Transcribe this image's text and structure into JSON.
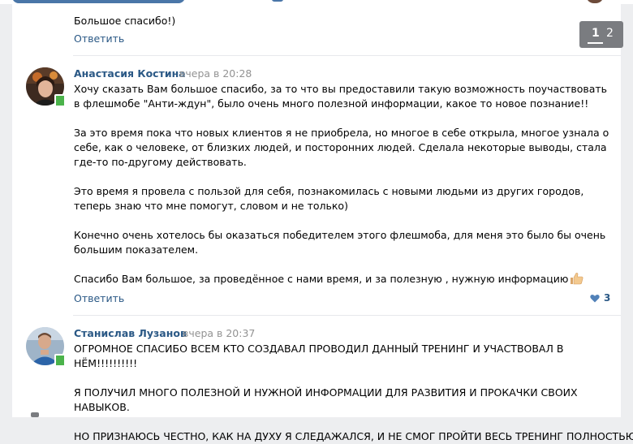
{
  "prev_comment": {
    "text": "Большое спасибо!)",
    "reply_label": "Ответить"
  },
  "pagination": {
    "current": "1",
    "next": "2"
  },
  "comments": [
    {
      "author": "Анастасия Костина",
      "date": "вчера в 20:28",
      "paragraphs": [
        "Хочу сказать Вам большое спасибо, за то что вы предоставили такую возможность поучаствовать в флешмобе \"Анти-ждун\", было очень много полезной информации, какое то новое познание!!",
        "За это время пока что новых клиентов я не приобрела, но многое в себе открыла, многое узнала о себе, как о человеке, от близких людей, и посторонних людей. Сделала некоторые выводы, стала где-то по-другому действовать.",
        "Это время я провела с пользой для себя, познакомилась с новыми людьми из других городов, теперь знаю что мне помогут, словом и не только)",
        "Конечно очень хотелось бы оказаться победителем этого флешмоба, для меня это было бы очень большим показателем.",
        "Спасибо Вам большое, за проведённое с нами время, и за полезную , нужную информацию"
      ],
      "emoji": "thumbs-up-icon",
      "reply_label": "Ответить",
      "likes": "3",
      "avatar_colors": [
        "#3d2a20",
        "#c46b2a"
      ]
    },
    {
      "author": "Станислав Лузанов",
      "date": "вчера в 20:37",
      "paragraphs": [
        "ОГРОМНОЕ СПАСИБО ВСЕМ КТО СОЗДАВАЛ ПРОВОДИЛ ДАННЫЙ ТРЕНИНГ И УЧАСТВОВАЛ В НЁМ!!!!!!!!!!",
        "Я ПОЛУЧИЛ МНОГО ПОЛЕЗНОЙ И НУЖНОЙ ИНФОРМАЦИИ ДЛЯ РАЗВИТИЯ И ПРОКАЧКИ СВОИХ НАВЫКОВ.",
        "НО ПРИЗНАЮСЬ ЧЕСТНО, КАК НА ДУХУ Я СЛЕДАЖАЛСЯ, И НЕ СМОГ ПРОЙТИ ВЕСЬ ТРЕНИНГ ПОЛНОСТЬЮ, ТАК"
      ],
      "avatar_colors": [
        "#9fb4c8",
        "#2c64a8"
      ]
    }
  ],
  "colors": {
    "link": "#2a5885",
    "date": "#939393",
    "online": "#4bb34b",
    "background": "#edeef0"
  }
}
